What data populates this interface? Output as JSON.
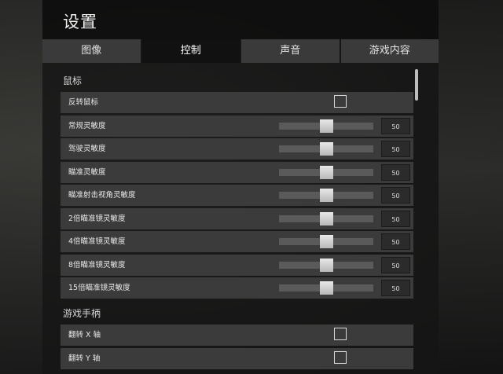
{
  "title": "设置",
  "tabs": [
    {
      "label": "图像",
      "active": false
    },
    {
      "label": "控制",
      "active": true
    },
    {
      "label": "声音",
      "active": false
    },
    {
      "label": "游戏内容",
      "active": false
    }
  ],
  "sections": {
    "mouse": {
      "title": "鼠标",
      "invert": {
        "label": "反转鼠标",
        "checked": false
      },
      "sliders": [
        {
          "label": "常规灵敏度",
          "value": "50"
        },
        {
          "label": "驾驶灵敏度",
          "value": "50"
        },
        {
          "label": "瞄准灵敏度",
          "value": "50"
        },
        {
          "label": "瞄准射击视角灵敏度",
          "value": "50"
        },
        {
          "label": "2倍瞄准镜灵敏度",
          "value": "50"
        },
        {
          "label": "4倍瞄准镜灵敏度",
          "value": "50"
        },
        {
          "label": "8倍瞄准镜灵敏度",
          "value": "50"
        },
        {
          "label": "15倍瞄准镜灵敏度",
          "value": "50"
        }
      ]
    },
    "gamepad": {
      "title": "游戏手柄",
      "rows": [
        {
          "label": "翻转 X 轴",
          "checked": false
        },
        {
          "label": "翻转 Y 轴",
          "checked": false
        }
      ]
    }
  },
  "slider_level_fraction": 0.5,
  "colors": {
    "row_bg": "#3b3b3b",
    "active_tab_bg": "#111111",
    "tab_bg": "#3a3a3a"
  }
}
